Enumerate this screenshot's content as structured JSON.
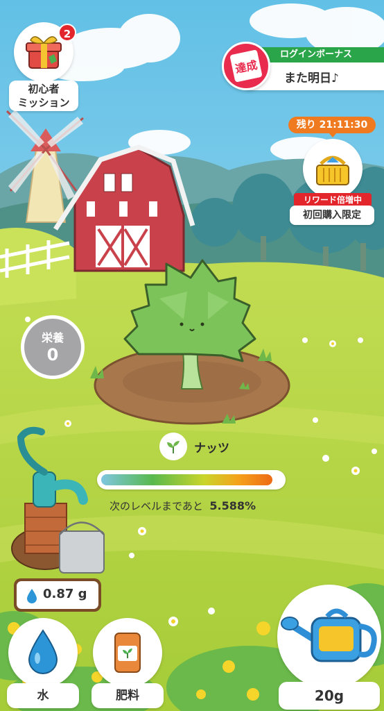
{
  "mission": {
    "badge_count": "2",
    "label_line1": "初心者",
    "label_line2": "ミッション"
  },
  "login_bonus": {
    "title": "ログインボーナス",
    "subtitle": "また明日♪",
    "stamp": "達成"
  },
  "shop": {
    "timer": "残り 21:11:30",
    "reward_tag": "リワード倍増中",
    "subtitle": "初回購入限定"
  },
  "nutrition": {
    "label": "栄養",
    "value": "0"
  },
  "plant": {
    "name": "ナッツ"
  },
  "progress": {
    "prefix": "次のレベルまであと",
    "value": "5.588%",
    "fraction": 0.95
  },
  "water_amount": "0.87 g",
  "buttons": {
    "water": "水",
    "fertilizer": "肥料",
    "watering_can": "20g"
  },
  "colors": {
    "sky": "#7ccbe8",
    "grass": "#b8d84a",
    "accent_green": "#2aa54a",
    "alert_red": "#e3262c",
    "timer_orange": "#f07a1f"
  }
}
